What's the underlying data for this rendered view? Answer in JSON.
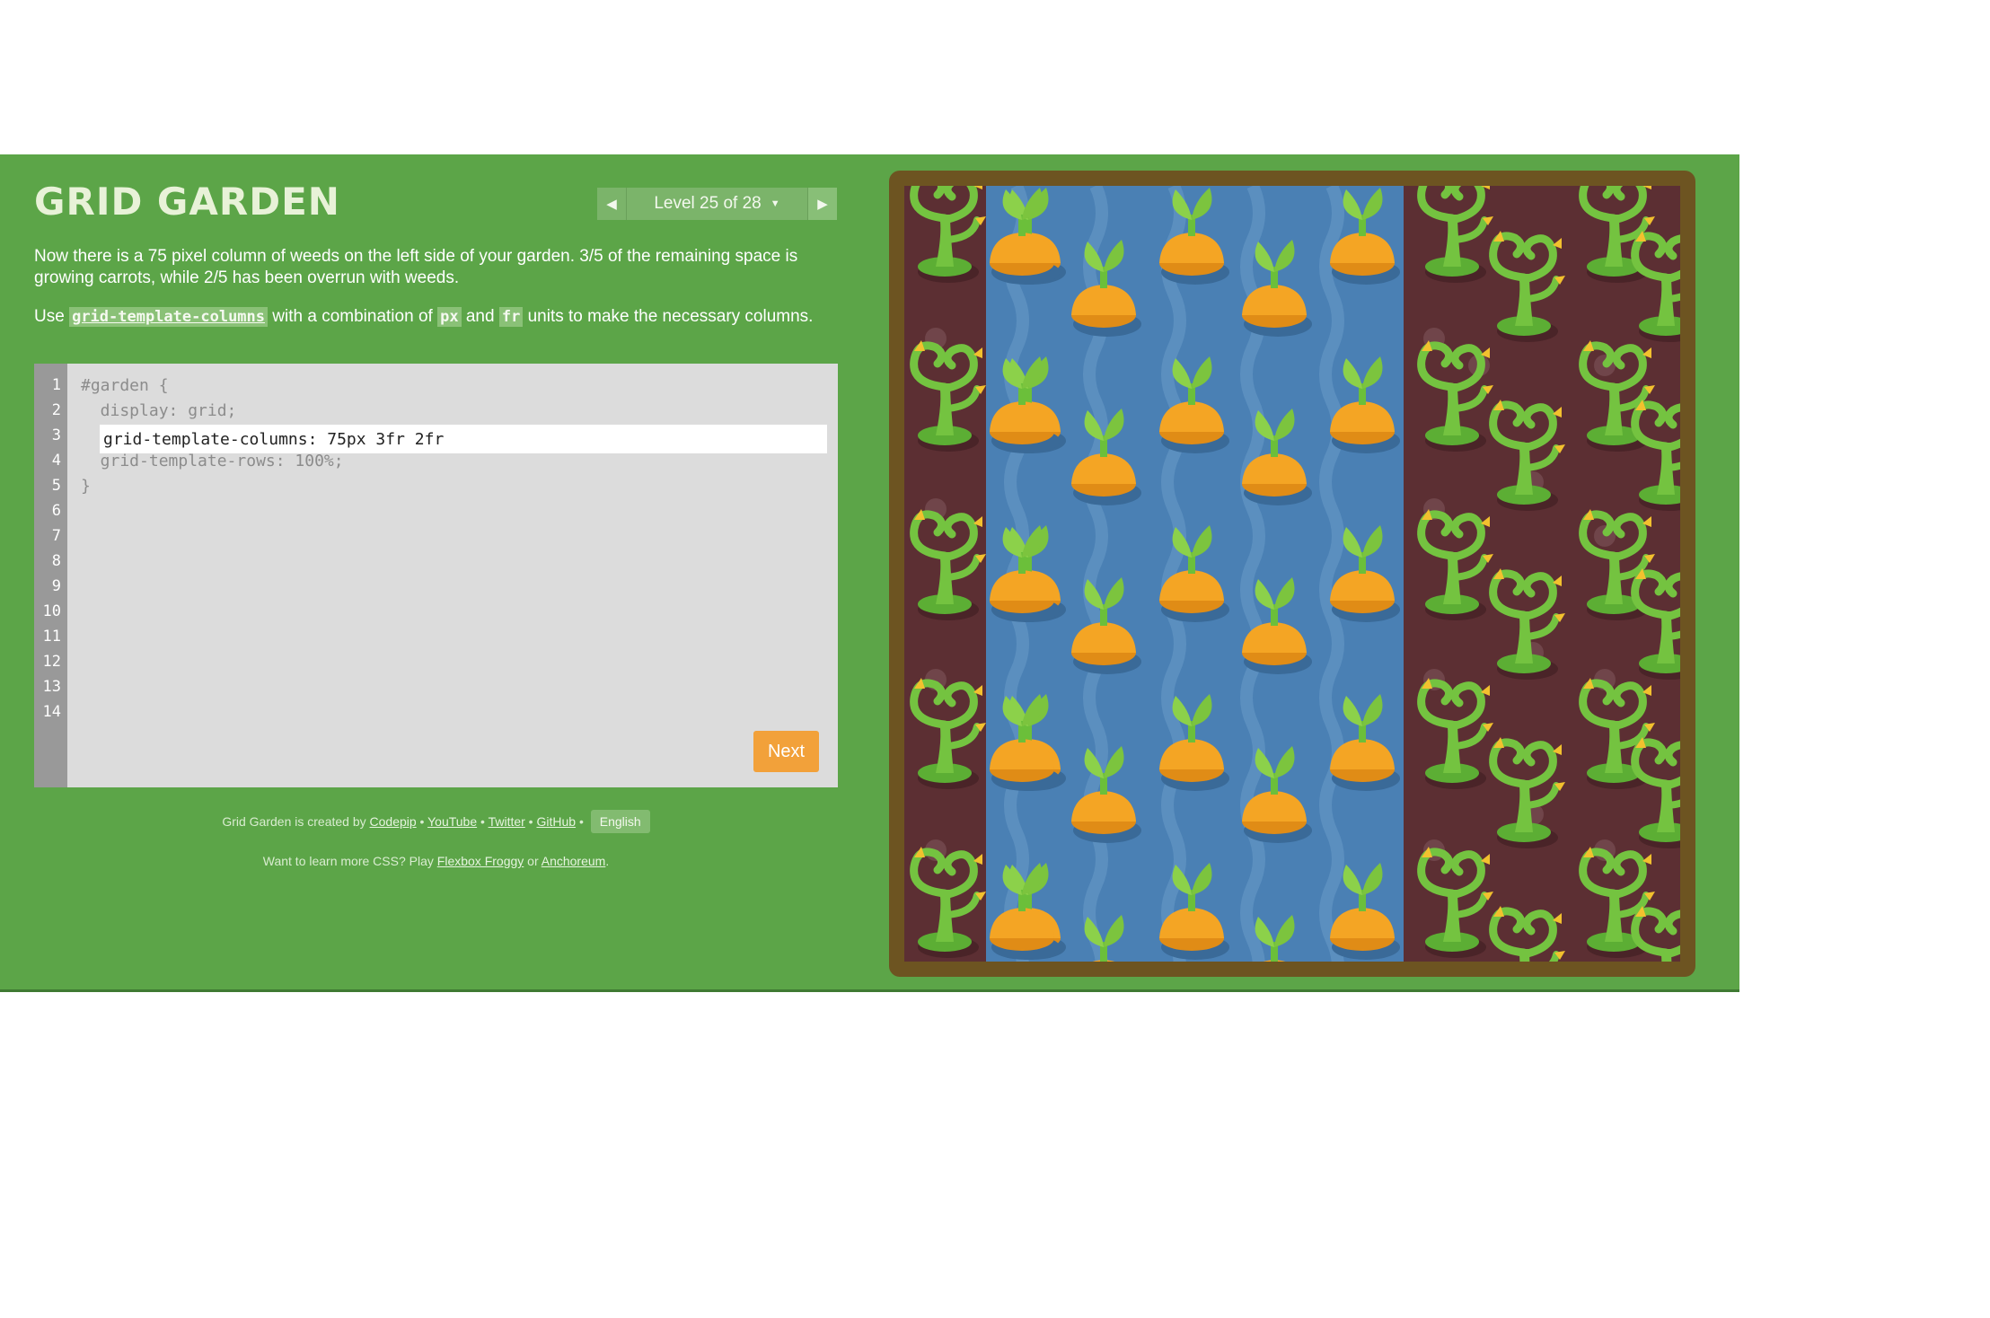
{
  "header": {
    "title": "GRID GARDEN",
    "level_label": "Level 25 of 28"
  },
  "instructions": {
    "p1": "Now there is a 75 pixel column of weeds on the left side of your garden. 3/5 of the remaining space is growing carrots, while 2/5 has been overrun with weeds.",
    "p2_prefix": "Use",
    "p2_code1": "grid-template-columns",
    "p2_mid1": "with a combination of",
    "p2_code2": "px",
    "p2_mid2": "and",
    "p2_code3": "fr",
    "p2_suffix": "units to make the necessary columns."
  },
  "editor": {
    "line_numbers": [
      "1",
      "2",
      "3",
      "4",
      "5",
      "6",
      "7",
      "8",
      "9",
      "10",
      "11",
      "12",
      "13",
      "14"
    ],
    "line1": "#garden {",
    "line2": "  display: grid;",
    "input_value": "grid-template-columns: 75px 3fr 2fr",
    "line4": "  grid-template-rows: 100%;",
    "line5": "}",
    "next_label": "Next"
  },
  "footer": {
    "created_by": "Grid Garden is created by",
    "codepip": "Codepip",
    "youtube": "YouTube",
    "twitter": "Twitter",
    "github": "GitHub",
    "language": "English",
    "learn_more": "Want to learn more CSS? Play",
    "flexbox_froggy": "Flexbox Froggy",
    "or": "or",
    "anchoreum": "Anchoreum"
  },
  "colors": {
    "background_green": "#5ca548",
    "next_button": "#f2a13a",
    "weeds": "#5c2f33",
    "water": "#4a80b4",
    "garden_border": "#6d5421"
  },
  "garden": {
    "columns": [
      "weeds",
      "carrots-water",
      "weeds"
    ],
    "carrot_count": 25,
    "icons": [
      "weed-icon",
      "carrot-icon"
    ]
  }
}
